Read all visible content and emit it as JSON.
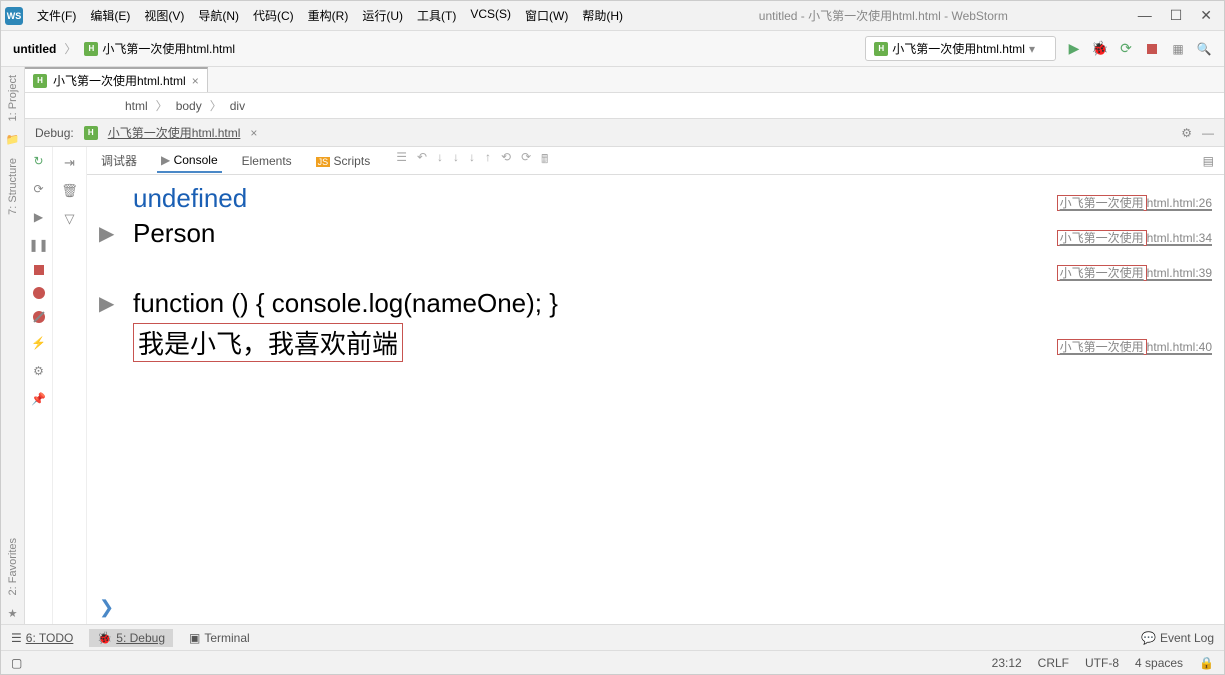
{
  "window": {
    "title": "untitled - 小飞第一次使用html.html - WebStorm"
  },
  "menu": {
    "file": "文件(F)",
    "edit": "编辑(E)",
    "view": "视图(V)",
    "nav": "导航(N)",
    "code": "代码(C)",
    "refactor": "重构(R)",
    "run": "运行(U)",
    "tools": "工具(T)",
    "vcs": "VCS(S)",
    "window": "窗口(W)",
    "help": "帮助(H)"
  },
  "nav": {
    "project": "untitled",
    "file": "小飞第一次使用html.html",
    "run_config": "小飞第一次使用html.html"
  },
  "left_tabs": {
    "project": "1: Project",
    "structure": "7: Structure",
    "favorites": "2: Favorites"
  },
  "editor": {
    "tab": "小飞第一次使用html.html",
    "breadcrumb": [
      "html",
      "body",
      "div"
    ]
  },
  "debug": {
    "label": "Debug:",
    "file": "小飞第一次使用html.html",
    "tabs": {
      "debugger": "调试器",
      "console": "Console",
      "elements": "Elements",
      "scripts": "Scripts"
    },
    "console": [
      {
        "type": "val",
        "text": "undefined",
        "src_cn": "小飞第一次使用",
        "src_en": "html.html:26"
      },
      {
        "type": "obj",
        "text": "Person",
        "src_cn": "小飞第一次使用",
        "src_en": "html.html:34"
      },
      {
        "type": "src_only",
        "src_cn": "小飞第一次使用",
        "src_en": "html.html:39"
      },
      {
        "type": "obj",
        "text": "function () { console.log(nameOne); }"
      },
      {
        "type": "boxed",
        "text": "我是小飞，我喜欢前端",
        "src_cn": "小飞第一次使用",
        "src_en": "html.html:40"
      }
    ]
  },
  "bottom": {
    "todo": "6: TODO",
    "debug": "5: Debug",
    "terminal": "Terminal",
    "event_log": "Event Log"
  },
  "status": {
    "pos": "23:12",
    "eol": "CRLF",
    "enc": "UTF-8",
    "indent": "4 spaces"
  }
}
